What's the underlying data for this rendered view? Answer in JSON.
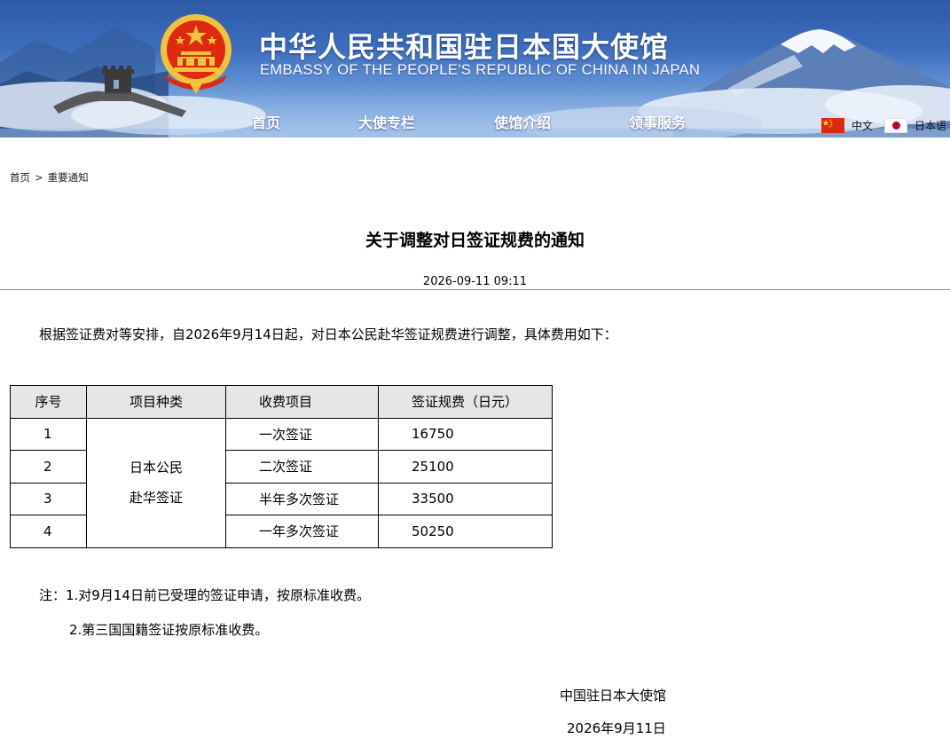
{
  "header": {
    "title": "中华人民共和国驻日本国大使馆",
    "subtitle": "EMBASSY OF THE PEOPLE'S REPUBLIC OF CHINA IN JAPAN",
    "emblem_icon": "national-emblem-icon",
    "nav": [
      {
        "label": "首页"
      },
      {
        "label": "大使专栏"
      },
      {
        "label": "使馆介绍"
      },
      {
        "label": "领事服务"
      }
    ],
    "languages": [
      {
        "label": "中文",
        "flag_icon": "china-flag-icon"
      },
      {
        "label": "日本语",
        "flag_icon": "japan-flag-icon"
      }
    ],
    "colors": {
      "banner_blue": "#2d5aa8",
      "flag_red": "#de2910",
      "emblem_gold": "#f2c23a"
    }
  },
  "breadcrumb": {
    "home": "首页",
    "separator": ">",
    "current": "重要通知"
  },
  "article": {
    "title": "关于调整对日签证规费的通知",
    "date": "2026-09-11 09:11",
    "intro": "根据签证费对等安排，自2026年9月14日起，对日本公民赴华签证规费进行调整，具体费用如下：",
    "table": {
      "headers": [
        "序号",
        "项目种类",
        "收费项目",
        "签证规费（日元）"
      ],
      "category": [
        "日本公民",
        "赴华签证"
      ],
      "rows": [
        {
          "no": "1",
          "item": "一次签证",
          "fee": "16750"
        },
        {
          "no": "2",
          "item": "二次签证",
          "fee": "25100"
        },
        {
          "no": "3",
          "item": "半年多次签证",
          "fee": "33500"
        },
        {
          "no": "4",
          "item": "一年多次签证",
          "fee": "50250"
        }
      ]
    },
    "notes": [
      "注：1.对9月14日前已受理的签证申请，按原标准收费。",
      "2.第三国国籍签证按原标准收费。"
    ],
    "signature": {
      "org": "中国驻日本大使馆",
      "date": "2026年9月11日"
    }
  }
}
